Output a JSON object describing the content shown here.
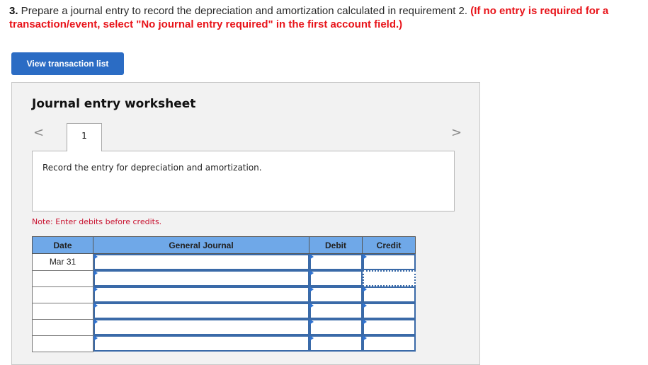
{
  "question": {
    "number": "3.",
    "text": " Prepare a journal entry to record the depreciation and amortization calculated in requirement 2. ",
    "instruction": "(If no entry is required for a transaction/event, select \"No journal entry required\" in the first account field.)"
  },
  "buttons": {
    "view_transaction_list": "View transaction list"
  },
  "worksheet": {
    "title": "Journal entry worksheet",
    "prev_icon": "chevron-left-icon",
    "next_icon": "chevron-right-icon",
    "prev_glyph": "<",
    "next_glyph": ">",
    "tabs": [
      {
        "label": "1"
      }
    ],
    "description": "Record the entry for depreciation and amortization.",
    "note": "Note: Enter debits before credits."
  },
  "journal": {
    "headers": {
      "date": "Date",
      "general_journal": "General Journal",
      "debit": "Debit",
      "credit": "Credit"
    },
    "rows": [
      {
        "date": "Mar 31",
        "account": "",
        "debit": "",
        "credit": ""
      },
      {
        "date": "",
        "account": "",
        "debit": "",
        "credit": ""
      },
      {
        "date": "",
        "account": "",
        "debit": "",
        "credit": ""
      },
      {
        "date": "",
        "account": "",
        "debit": "",
        "credit": ""
      },
      {
        "date": "",
        "account": "",
        "debit": "",
        "credit": ""
      },
      {
        "date": "",
        "account": "",
        "debit": "",
        "credit": ""
      }
    ]
  },
  "colors": {
    "button_blue": "#2b6cc4",
    "header_blue": "#6fa8e8",
    "field_border": "#3a6aa8",
    "instruction_red": "#e8141a",
    "note_red": "#c8102e"
  }
}
